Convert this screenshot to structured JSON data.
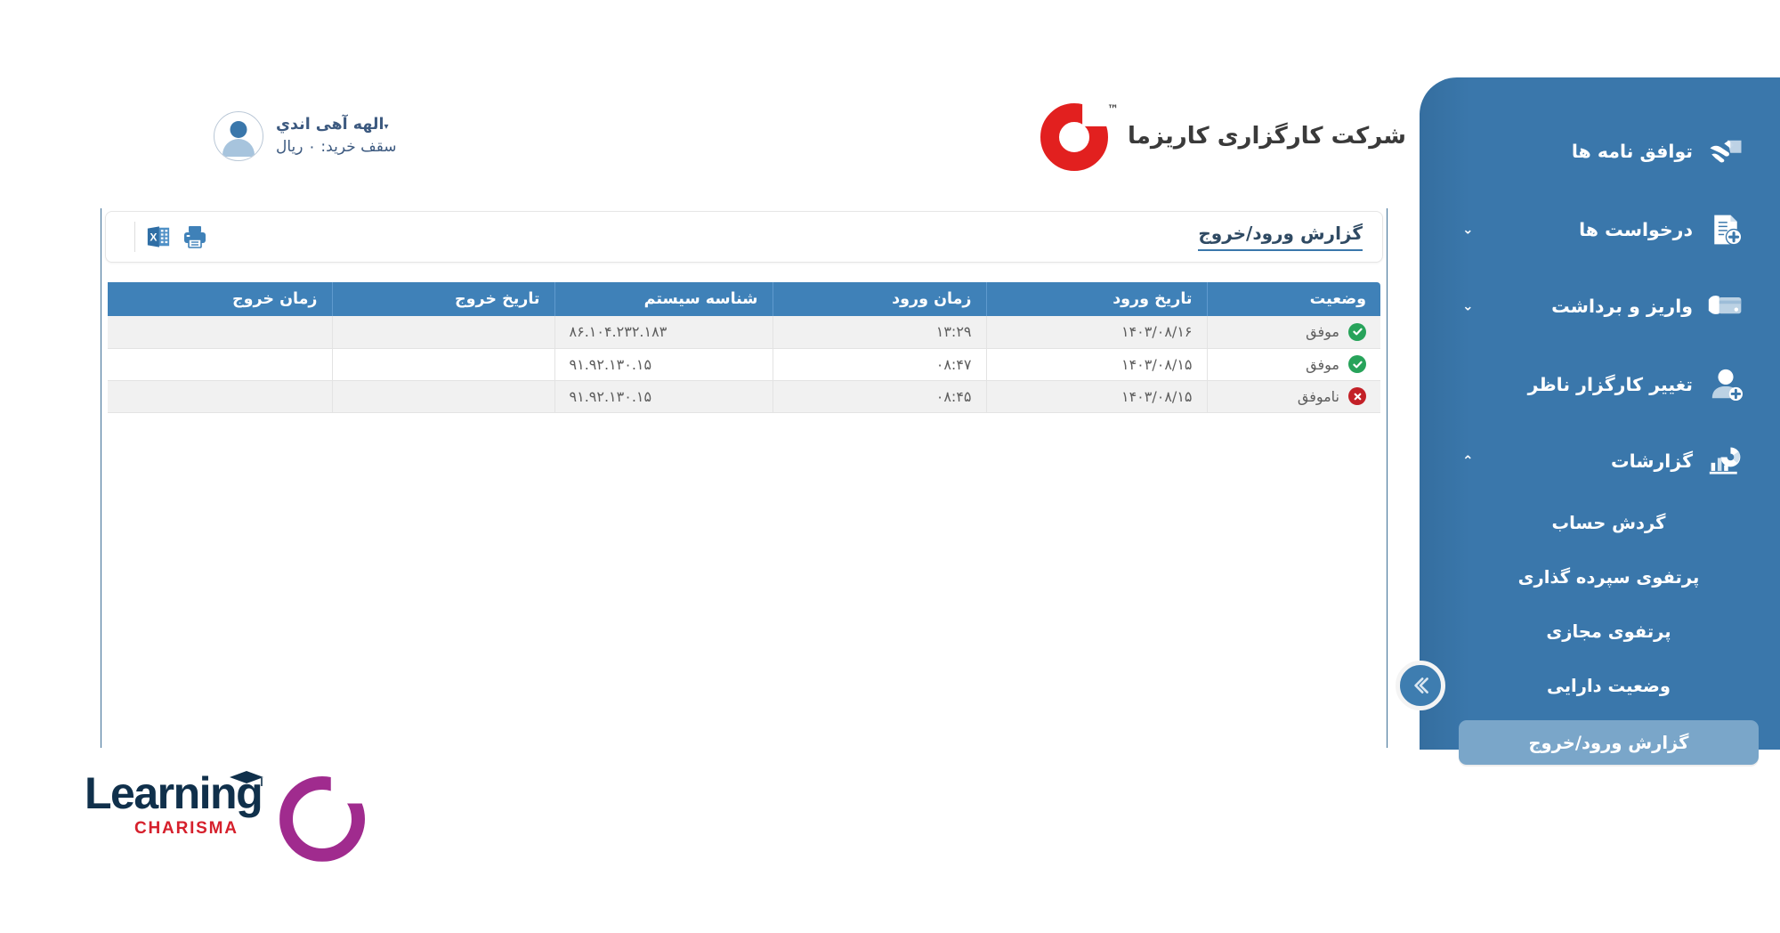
{
  "header": {
    "brand_name": "شرکت کارگزاری کاریزما",
    "brand_tm": "™",
    "brand_color": "#e2201f",
    "user_name": "الهه آهی اندي",
    "user_caret": "▾",
    "user_limit": "سقف خرید: ۰ ریال"
  },
  "sidebar": {
    "bg_color": "#3a77ab",
    "active_color": "#7aa6c9",
    "toggle_icon": "chevrons-right-icon",
    "items": [
      {
        "label": "توافق نامه ها",
        "icon": "handshake-icon",
        "chevron": "",
        "expandable": false
      },
      {
        "label": "درخواست ها",
        "icon": "document-add-icon",
        "chevron": "⌄",
        "expandable": true
      },
      {
        "label": "واریز و برداشت",
        "icon": "credit-card-icon",
        "chevron": "⌄",
        "expandable": true
      },
      {
        "label": "تغییر کارگزار ناظر",
        "icon": "user-add-icon",
        "chevron": "",
        "expandable": false
      },
      {
        "label": "گزارشات",
        "icon": "reports-chart-icon",
        "chevron": "⌃",
        "expandable": true
      }
    ],
    "sub_items": [
      {
        "label": "گردش حساب",
        "active": false
      },
      {
        "label": "پرتفوی سپرده گذاری",
        "active": false
      },
      {
        "label": "پرتفوی مجازی",
        "active": false
      },
      {
        "label": "وضعیت دارایی",
        "active": false
      },
      {
        "label": "گزارش ورود/خروج",
        "active": true
      }
    ]
  },
  "main": {
    "page_title": "گزارش ورود/خروج",
    "tools": [
      {
        "name": "print-icon",
        "label": "چاپ"
      },
      {
        "name": "excel-export-icon",
        "label": "خروجی اکسل"
      }
    ],
    "table": {
      "columns": [
        {
          "key": "status",
          "label": "وضعیت"
        },
        {
          "key": "login_date",
          "label": "تاریخ ورود"
        },
        {
          "key": "login_time",
          "label": "زمان ورود"
        },
        {
          "key": "system_id",
          "label": "شناسه سیستم"
        },
        {
          "key": "logout_date",
          "label": "تاریخ خروج"
        },
        {
          "key": "logout_time",
          "label": "زمان خروج"
        }
      ],
      "rows": [
        {
          "status": "موفق",
          "status_kind": "ok",
          "login_date": "۱۴۰۳/۰۸/۱۶",
          "login_time": "۱۳:۲۹",
          "system_id": "۸۶.۱۰۴.۲۳۲.۱۸۳",
          "logout_date": "",
          "logout_time": ""
        },
        {
          "status": "موفق",
          "status_kind": "ok",
          "login_date": "۱۴۰۳/۰۸/۱۵",
          "login_time": "۰۸:۴۷",
          "system_id": "۹۱.۹۲.۱۳۰.۱۵",
          "logout_date": "",
          "logout_time": ""
        },
        {
          "status": "ناموفق",
          "status_kind": "fail",
          "login_date": "۱۴۰۳/۰۸/۱۵",
          "login_time": "۰۸:۴۵",
          "system_id": "۹۱.۹۲.۱۳۰.۱۵",
          "logout_date": "",
          "logout_time": ""
        }
      ]
    }
  },
  "footer": {
    "logo_word": "Learning",
    "logo_sub": "CHARISMA",
    "logo_ring_color": "#a02b8e",
    "logo_word_color": "#10304b",
    "logo_sub_color": "#d6202c"
  }
}
